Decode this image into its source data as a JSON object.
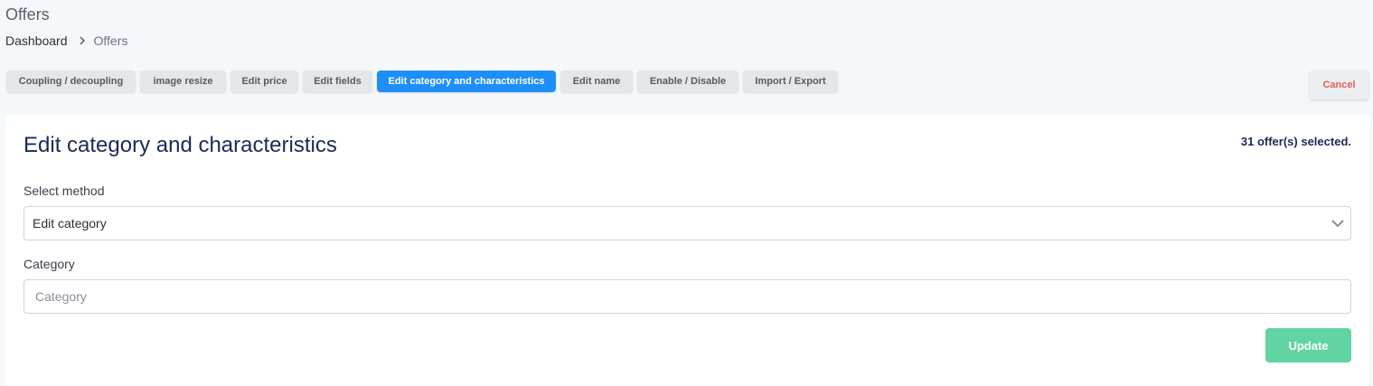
{
  "page": {
    "title": "Offers"
  },
  "breadcrumb": {
    "home": "Dashboard",
    "current": "Offers"
  },
  "tabs": [
    {
      "label": "Coupling / decoupling",
      "active": false
    },
    {
      "label": "image resize",
      "active": false
    },
    {
      "label": "Edit price",
      "active": false
    },
    {
      "label": "Edit fields",
      "active": false
    },
    {
      "label": "Edit category and characteristics",
      "active": true
    },
    {
      "label": "Edit name",
      "active": false
    },
    {
      "label": "Enable / Disable",
      "active": false
    },
    {
      "label": "Import / Export",
      "active": false
    }
  ],
  "actions": {
    "cancel_label": "Cancel"
  },
  "panel": {
    "title": "Edit category and characteristics",
    "selected_text": "31 offer(s) selected.",
    "method_label": "Select method",
    "method_value": "Edit category",
    "category_label": "Category",
    "category_placeholder": "Category",
    "category_value": "",
    "update_label": "Update"
  },
  "colors": {
    "accent": "#1e8ff7",
    "update": "#62d3a3",
    "cancel_text": "#e25c5c",
    "title_text": "#1c2a55"
  },
  "icons": {
    "breadcrumb_separator": "chevron-right-icon",
    "select_arrow": "chevron-down-icon"
  }
}
